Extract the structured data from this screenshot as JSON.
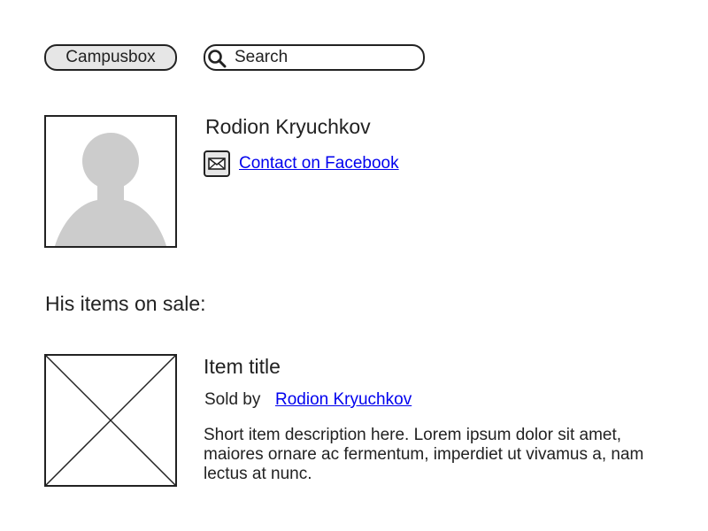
{
  "header": {
    "home_label": "Campusbox",
    "search": {
      "placeholder": "Search",
      "icon": "search-icon"
    }
  },
  "profile": {
    "name": "Rodion Kryuchkov",
    "avatar_icon": "user-placeholder-icon",
    "contact": {
      "icon": "mail-icon",
      "label": "Contact on Facebook"
    }
  },
  "items_section": {
    "heading": "His items on sale:",
    "items": [
      {
        "image_icon": "image-placeholder-icon",
        "title": "Item title",
        "sold_by_label": "Sold by",
        "seller": "Rodion Kryuchkov",
        "description": "Short item description here. Lorem ipsum dolor sit amet, maiores ornare ac fermentum, imperdiet ut vivamus a, nam lectus at nunc."
      }
    ]
  },
  "colors": {
    "text": "#222222",
    "link": "#0000ee",
    "placeholder_fill": "#cccccc",
    "button_fill": "#e6e6e6"
  }
}
